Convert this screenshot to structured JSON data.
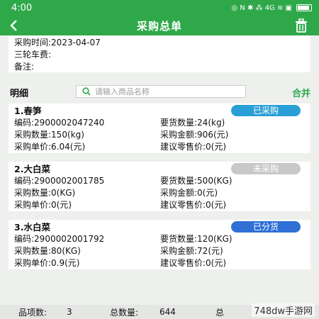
{
  "status_bar": {
    "time": "4:00",
    "icons_text": "◎ N ✱ ⁂ 4G ≋ ▣"
  },
  "nav": {
    "title": "采购总单"
  },
  "info": {
    "date_line": "采购时间:2023-04-07",
    "tricycle_line": "三轮车费:",
    "remark_line": "备注:"
  },
  "detail": {
    "title": "明细",
    "search_placeholder": "请输入商品名称",
    "merge_label": "合并"
  },
  "items": [
    {
      "name": "1.春笋",
      "status": "已采购",
      "status_color": "#2a9fd6",
      "code": "编码:2900002047240",
      "required_qty": "要货数量:24(kg)",
      "purchase_qty": "采购数量:150(kg)",
      "purchase_amount": "采购金额:906(元)",
      "unit_price": "采购单价:6.04(元)",
      "retail_price": "建议零售价:0(元)"
    },
    {
      "name": "2.大白菜",
      "status": "未采购",
      "status_color": "#c8c8c8",
      "code": "编码:2900002001785",
      "required_qty": "要货数量:500(KG)",
      "purchase_qty": "采购数量:0(KG)",
      "purchase_amount": "采购金额:0(元)",
      "unit_price": "采购单价:0(元)",
      "retail_price": "建议零售价:0(元)"
    },
    {
      "name": "3.水白菜",
      "status": "已分货",
      "status_color": "#2f6fd6",
      "code": "编码:2900002001792",
      "required_qty": "要货数量:120(KG)",
      "purchase_qty": "采购数量:80(KG)",
      "purchase_amount": "采购金额:72(元)",
      "unit_price": "采购单价:0.9(元)",
      "retail_price": "建议零售价:0(元)"
    }
  ],
  "summary": {
    "item_count_label": "品项数:",
    "item_count": "3",
    "total_qty_label": "总数量:",
    "total_qty": "644",
    "total_cut": "总"
  },
  "watermark": "748dw手游网",
  "colors": {
    "accent": "#2fa84a"
  }
}
